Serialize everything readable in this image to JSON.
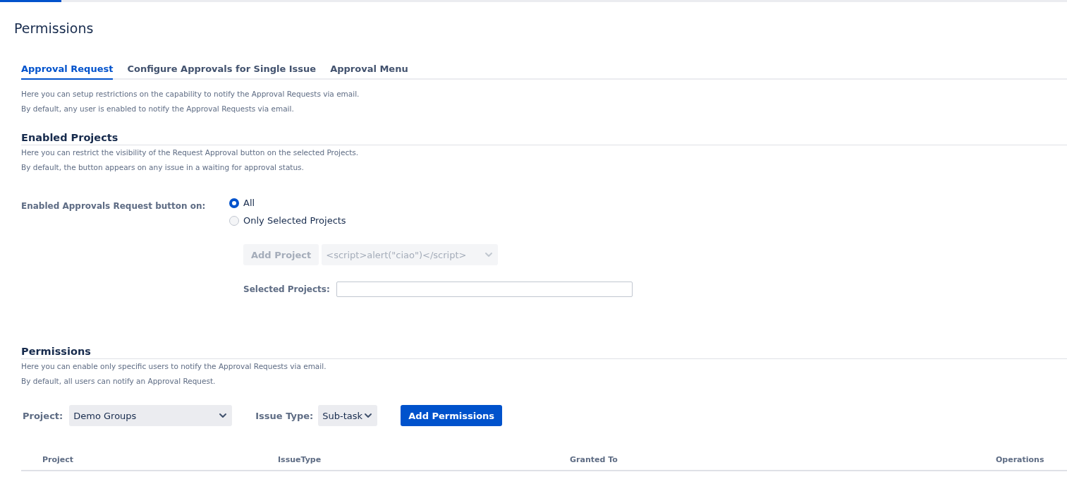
{
  "page": {
    "title": "Permissions"
  },
  "tabs": [
    {
      "label": "Approval Request",
      "selected": true
    },
    {
      "label": "Configure Approvals for Single Issue",
      "selected": false
    },
    {
      "label": "Approval Menu",
      "selected": false
    }
  ],
  "intro": [
    "Here you can setup restrictions on the capability to notify the Approval Requests via email.",
    "By default, any user is enabled to notify the Approval Requests via email."
  ],
  "enabled_projects": {
    "heading": "Enabled Projects",
    "description": [
      "Here you can restrict the visibility of the Request Approval button on the selected Projects.",
      "By default, the button appears on any issue in a waiting for approval status."
    ],
    "field_label": "Enabled Approvals Request button on:",
    "options": [
      {
        "label": "All",
        "selected": true
      },
      {
        "label": "Only Selected Projects",
        "selected": false
      }
    ],
    "add_project_button": {
      "label": "Add Project",
      "disabled": true
    },
    "project_select": {
      "value": "<script>alert(\"ciao\")</script>",
      "disabled": true
    },
    "selected_projects_label": "Selected Projects:"
  },
  "permissions": {
    "heading": "Permissions",
    "description": [
      "Here you can enable only specific users to notify the Approval Requests via email.",
      "By default, all users can notify an Approval Request."
    ],
    "project_label": "Project:",
    "project_select": {
      "value": "Demo Groups"
    },
    "issue_type_label": "Issue Type:",
    "issue_type_select": {
      "value": "Sub-task"
    },
    "add_button": "Add Permissions",
    "table": {
      "columns": [
        "Project",
        "IssueType",
        "Granted To",
        "Operations"
      ]
    }
  }
}
